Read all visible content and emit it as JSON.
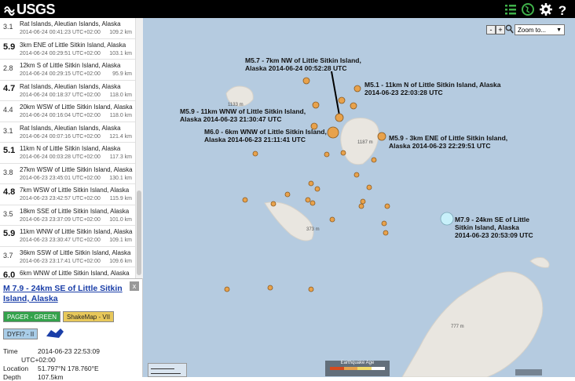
{
  "header": {
    "logo": "USGS",
    "icons": [
      "list-icon",
      "map-icon",
      "gear-icon",
      "help-icon"
    ]
  },
  "earthquake_list": [
    {
      "mag": "3.1",
      "place": "Rat Islands, Aleutian Islands, Alaska",
      "time": "2014-06-24 00:41:23 UTC+02:00",
      "depth": "109.2 km",
      "big": false
    },
    {
      "mag": "5.9",
      "place": "3km ENE of Little Sitkin Island, Alaska",
      "time": "2014-06-24 00:29:51 UTC+02:00",
      "depth": "103.1 km",
      "big": true
    },
    {
      "mag": "2.8",
      "place": "12km S of Little Sitkin Island, Alaska",
      "time": "2014-06-24 00:29:15 UTC+02:00",
      "depth": "95.9 km",
      "big": false
    },
    {
      "mag": "4.7",
      "place": "Rat Islands, Aleutian Islands, Alaska",
      "time": "2014-06-24 00:18:37 UTC+02:00",
      "depth": "118.0 km",
      "big": true
    },
    {
      "mag": "4.4",
      "place": "20km WSW of Little Sitkin Island, Alaska",
      "time": "2014-06-24 00:16:04 UTC+02:00",
      "depth": "118.0 km",
      "big": false
    },
    {
      "mag": "3.1",
      "place": "Rat Islands, Aleutian Islands, Alaska",
      "time": "2014-06-24 00:07:16 UTC+02:00",
      "depth": "121.4 km",
      "big": false
    },
    {
      "mag": "5.1",
      "place": "11km N of Little Sitkin Island, Alaska",
      "time": "2014-06-24 00:03:28 UTC+02:00",
      "depth": "117.3 km",
      "big": true
    },
    {
      "mag": "3.8",
      "place": "27km WSW of Little Sitkin Island, Alaska",
      "time": "2014-06-23 23:45:01 UTC+02:00",
      "depth": "130.1 km",
      "big": false
    },
    {
      "mag": "4.8",
      "place": "7km WSW of Little Sitkin Island, Alaska",
      "time": "2014-06-23 23:42:57 UTC+02:00",
      "depth": "115.9 km",
      "big": true
    },
    {
      "mag": "3.5",
      "place": "18km SSE of Little Sitkin Island, Alaska",
      "time": "2014-06-23 23:37:09 UTC+02:00",
      "depth": "101.0 km",
      "big": false
    },
    {
      "mag": "5.9",
      "place": "11km WNW of Little Sitkin Island, Alaska",
      "time": "2014-06-23 23:30:47 UTC+02:00",
      "depth": "109.1 km",
      "big": true
    },
    {
      "mag": "3.7",
      "place": "36km SSW of Little Sitkin Island, Alaska",
      "time": "2014-06-23 23:17:41 UTC+02:00",
      "depth": "109.6 km",
      "big": false
    },
    {
      "mag": "6.0",
      "place": "6km WNW of Little Sitkin Island, Alaska",
      "time": "",
      "depth": "",
      "big": true
    }
  ],
  "detail": {
    "title": "M 7.9 - 24km SE of Little Sitkin Island, Alaska",
    "close": "x",
    "pager_label": "PAGER - GREEN",
    "shakemap_label": "ShakeMap - VII",
    "dyfi_label": "DYFI? - II",
    "time_label": "Time",
    "time_value": "2014-06-23 22:53:09",
    "time_value2": "UTC+02:00",
    "location_label": "Location",
    "location_value": "51.797°N 178.760°E",
    "depth_label": "Depth",
    "depth_value": "107.5km"
  },
  "map": {
    "zoom_minus": "-",
    "zoom_plus": "+",
    "zoom_select": "Zoom to...",
    "labels": [
      {
        "l1": "M5.7 - 7km NW of Little Sitkin Island,",
        "l2": "Alaska 2014-06-24 00:52:28 UTC"
      },
      {
        "l1": "M5.1 - 11km N of Little Sitkin Island, Alaska",
        "l2": "2014-06-23 22:03:28 UTC"
      },
      {
        "l1": "M5.9 - 11km WNW of Little Sitkin Island,",
        "l2": "Alaska 2014-06-23 21:30:47 UTC"
      },
      {
        "l1": "M6.0 - 6km WNW of Little Sitkin Island,",
        "l2": "Alaska 2014-06-23 21:11:41 UTC"
      },
      {
        "l1": "M5.9 - 3km ENE of Little Sitkin Island,",
        "l2": "Alaska 2014-06-23 22:29:51 UTC"
      },
      {
        "l1": "M7.9 - 24km SE of Little",
        "l2": "Sitkin Island, Alaska",
        "l3": "2014-06-23 20:53:09 UTC"
      }
    ],
    "elevations": [
      "1133 m",
      "1187 m",
      "373 m",
      "777 m"
    ],
    "legend_title": "Earthquake Age",
    "colors": {
      "quake": "#e8a24c",
      "mainshock": "#c8f0fa",
      "water": "#b5cbe0",
      "land": "#e9e6e0"
    }
  }
}
